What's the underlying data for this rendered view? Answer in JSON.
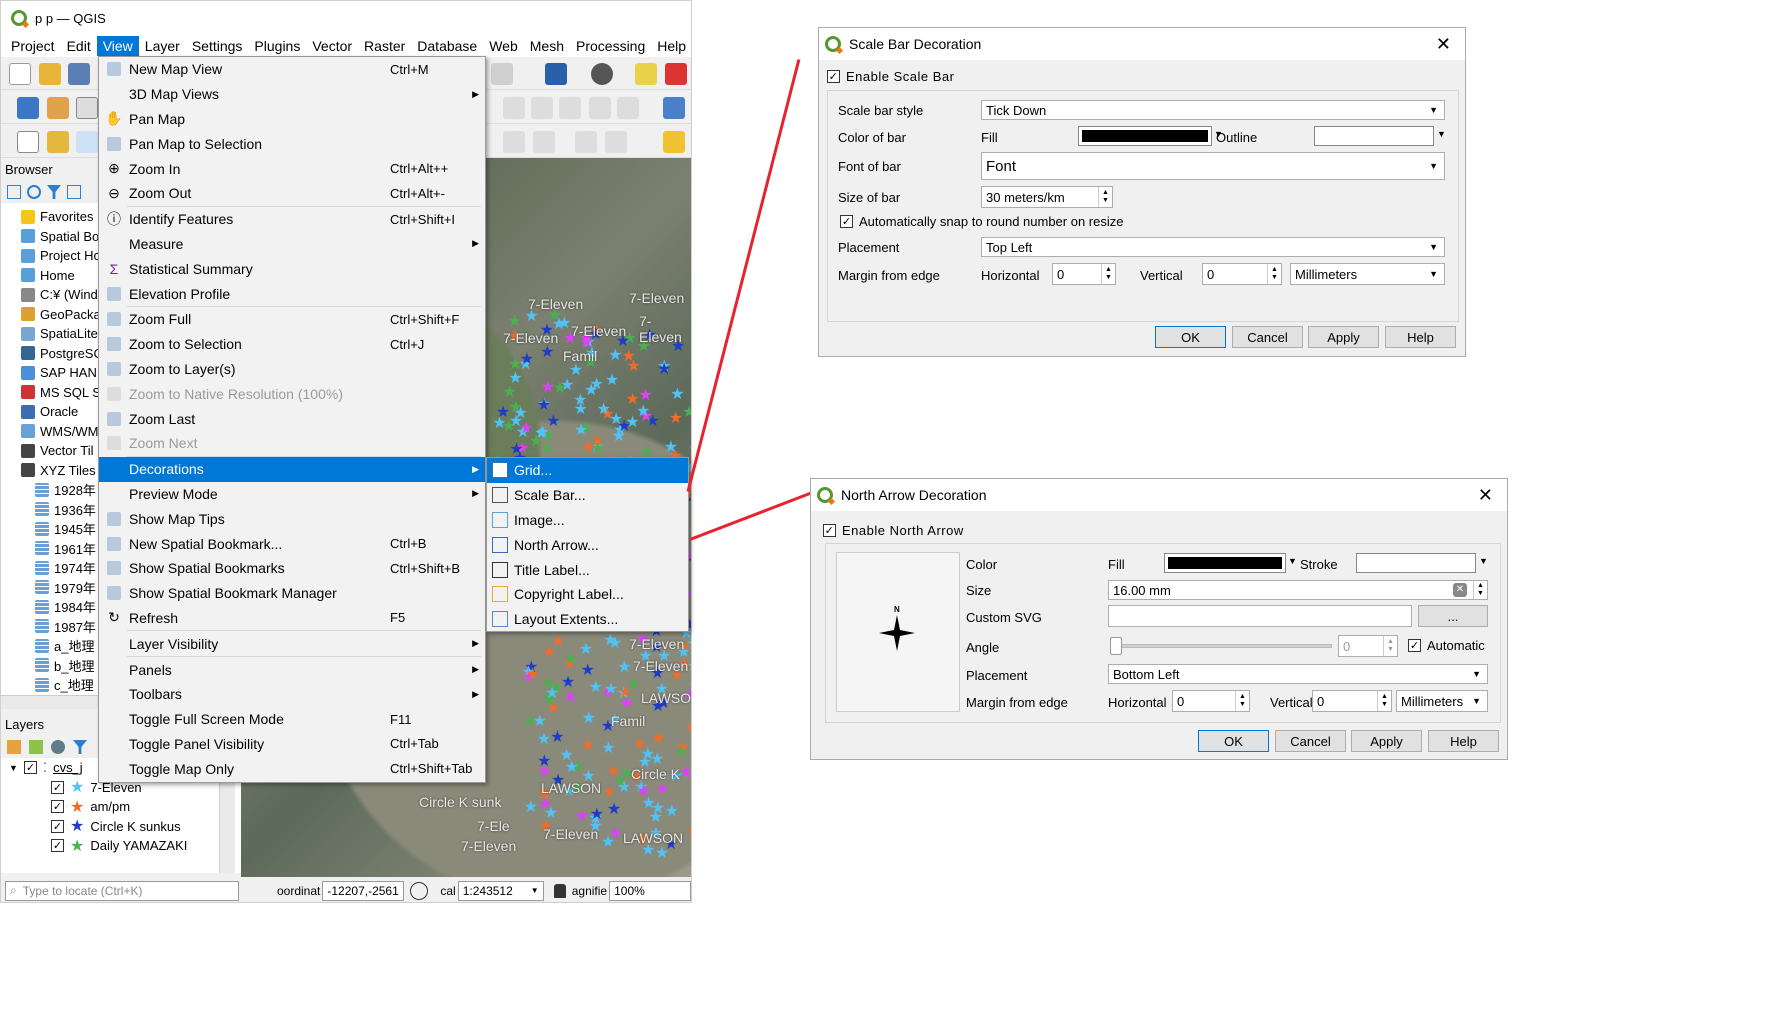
{
  "window": {
    "title": "p p — QGIS"
  },
  "menubar": [
    "Project",
    "Edit",
    "View",
    "Layer",
    "Settings",
    "Plugins",
    "Vector",
    "Raster",
    "Database",
    "Web",
    "Mesh",
    "Processing",
    "Help"
  ],
  "browser": {
    "title": "Browser",
    "items": [
      "Favorites",
      "Spatial Bo",
      "Project Ho",
      "Home",
      "C:¥ (Wind",
      "GeoPacka",
      "SpatiaLite",
      "PostgreSC",
      "SAP HAN",
      "MS SQL S",
      "Oracle",
      "WMS/WM",
      "Vector Til",
      "XYZ Tiles",
      "1928年",
      "1936年",
      "1945年",
      "1961年",
      "1974年",
      "1979年",
      "1984年",
      "1987年",
      "a_地理",
      "b_地理",
      "c_地理"
    ]
  },
  "layers": {
    "title": "Layers",
    "group": "cvs_j",
    "items": [
      "7-Eleven",
      "am/pm",
      "Circle K sunkus",
      "Daily YAMAZAKI"
    ],
    "colors": [
      "#4fc3f7",
      "#ef6c2a",
      "#1e3cc8",
      "#4caf50"
    ]
  },
  "statusbar": {
    "locate_placeholder": "Type to locate (Ctrl+K)",
    "coord_label": "oordinat",
    "coord_value": "-12207,-2561",
    "scale_label": "cal",
    "scale_value": "1:243512",
    "magnifier_label": "agnifie",
    "magnifier_value": "100%"
  },
  "map_labels": [
    "7-Eleven",
    "7-Eleven",
    "7-Eleven",
    "7-Eleven",
    "7-Eleven",
    "Famil",
    "LAWSON",
    "Circle K",
    "Circle K sunk",
    "LAWSON",
    "7-Ele",
    "7-Eleven",
    "7-Eleven",
    "LAWSON",
    "7-Eleven",
    "7-Eleven",
    "Famil"
  ],
  "view_menu": [
    {
      "label": "New Map View",
      "shortcut": "Ctrl+M",
      "icon": "new-map-view-icon"
    },
    {
      "label": "3D Map Views",
      "submenu": true
    },
    {
      "label": "Pan Map",
      "icon": "pan-hand-icon"
    },
    {
      "label": "Pan Map to Selection",
      "icon": "pan-selection-icon"
    },
    {
      "label": "Zoom In",
      "shortcut": "Ctrl+Alt++",
      "icon": "zoom-in-icon"
    },
    {
      "label": "Zoom Out",
      "shortcut": "Ctrl+Alt+-",
      "icon": "zoom-out-icon"
    },
    {
      "sep": true
    },
    {
      "label": "Identify Features",
      "shortcut": "Ctrl+Shift+I",
      "icon": "identify-icon"
    },
    {
      "label": "Measure",
      "submenu": true
    },
    {
      "label": "Statistical Summary",
      "icon": "sigma-icon"
    },
    {
      "label": "Elevation Profile",
      "icon": "elevation-icon"
    },
    {
      "sep": true
    },
    {
      "label": "Zoom Full",
      "shortcut": "Ctrl+Shift+F",
      "icon": "zoom-full-icon"
    },
    {
      "label": "Zoom to Selection",
      "shortcut": "Ctrl+J",
      "icon": "zoom-selection-icon"
    },
    {
      "label": "Zoom to Layer(s)",
      "icon": "zoom-layer-icon"
    },
    {
      "label": "Zoom to Native Resolution (100%)",
      "disabled": true,
      "icon": "zoom-native-icon"
    },
    {
      "label": "Zoom Last",
      "icon": "zoom-last-icon"
    },
    {
      "label": "Zoom Next",
      "disabled": true,
      "icon": "zoom-next-icon"
    },
    {
      "sep": true
    },
    {
      "label": "Decorations",
      "submenu": true,
      "highlight": true
    },
    {
      "label": "Preview Mode",
      "submenu": true
    },
    {
      "label": "Show Map Tips",
      "icon": "map-tips-icon"
    },
    {
      "label": "New Spatial Bookmark...",
      "shortcut": "Ctrl+B",
      "icon": "new-bookmark-icon"
    },
    {
      "label": "Show Spatial Bookmarks",
      "shortcut": "Ctrl+Shift+B",
      "icon": "bookmarks-icon"
    },
    {
      "label": "Show Spatial Bookmark Manager",
      "icon": "bookmark-manager-icon"
    },
    {
      "label": "Refresh",
      "shortcut": "F5",
      "icon": "refresh-icon"
    },
    {
      "sep": true
    },
    {
      "label": "Layer Visibility",
      "submenu": true
    },
    {
      "sep": true
    },
    {
      "label": "Panels",
      "submenu": true
    },
    {
      "label": "Toolbars",
      "submenu": true
    },
    {
      "label": "Toggle Full Screen Mode",
      "shortcut": "F11"
    },
    {
      "label": "Toggle Panel Visibility",
      "shortcut": "Ctrl+Tab"
    },
    {
      "label": "Toggle Map Only",
      "shortcut": "Ctrl+Shift+Tab"
    }
  ],
  "decorations_menu": [
    {
      "label": "Grid...",
      "icon": "grid-icon",
      "highlight": true
    },
    {
      "label": "Scale Bar...",
      "icon": "scale-bar-icon"
    },
    {
      "label": "Image...",
      "icon": "image-icon"
    },
    {
      "label": "North Arrow...",
      "icon": "north-arrow-icon"
    },
    {
      "label": "Title Label...",
      "icon": "title-label-icon"
    },
    {
      "label": "Copyright Label...",
      "icon": "copyright-icon"
    },
    {
      "label": "Layout Extents...",
      "icon": "layout-extents-icon"
    }
  ],
  "scale_bar_dialog": {
    "title": "Scale Bar Decoration",
    "enable_label": "Enable Scale Bar",
    "style_label": "Scale bar style",
    "style_value": "Tick Down",
    "color_label": "Color of bar",
    "fill_label": "Fill",
    "fill_color": "#000000",
    "outline_label": "Outline",
    "font_label": "Font of bar",
    "font_value": "Font",
    "size_label": "Size of bar",
    "size_value": "30 meters/km",
    "snap_label": "Automatically snap to round number on resize",
    "placement_label": "Placement",
    "placement_value": "Top Left",
    "margin_label": "Margin from edge",
    "horizontal_label": "Horizontal",
    "horizontal_value": "0",
    "vertical_label": "Vertical",
    "vertical_value": "0",
    "unit_value": "Millimeters",
    "buttons": [
      "OK",
      "Cancel",
      "Apply",
      "Help"
    ]
  },
  "north_arrow_dialog": {
    "title": "North Arrow Decoration",
    "enable_label": "Enable North Arrow",
    "preview_letter": "N",
    "color_label": "Color",
    "fill_label": "Fill",
    "fill_color": "#000000",
    "stroke_label": "Stroke",
    "size_label": "Size",
    "size_value": "16.00 mm",
    "svg_label": "Custom SVG",
    "svg_button": "...",
    "angle_label": "Angle",
    "angle_value": "0",
    "automatic_label": "Automatic",
    "placement_label": "Placement",
    "placement_value": "Bottom Left",
    "margin_label": "Margin from edge",
    "horizontal_label": "Horizontal",
    "horizontal_value": "0",
    "vertical_label": "Vertical",
    "vertical_value": "0",
    "unit_value": "Millimeters",
    "buttons": [
      "OK",
      "Cancel",
      "Apply",
      "Help"
    ]
  },
  "accent_color": "#0078d7",
  "connector_color": "#e8232f"
}
